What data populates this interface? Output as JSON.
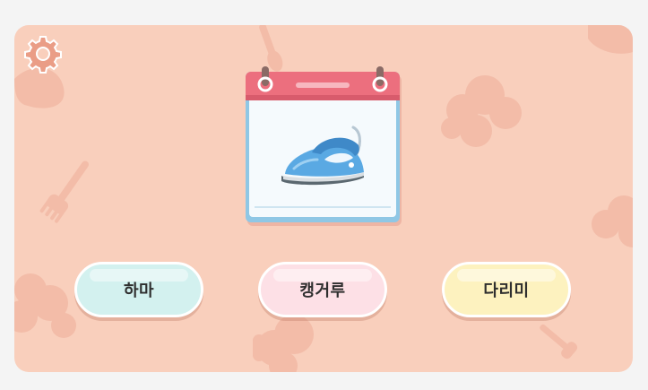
{
  "game": {
    "settings_icon": "gear-icon",
    "question_image": "clothes-iron",
    "answers": [
      {
        "label": "하마",
        "color": "#d3f1ef"
      },
      {
        "label": "캥거루",
        "color": "#fde0e6"
      },
      {
        "label": "다리미",
        "color": "#fdf2bf"
      }
    ]
  },
  "colors": {
    "background": "#f9cfbc",
    "calendar_header": "#ec6f7e",
    "calendar_border": "#8fc7e5",
    "iron_blue": "#5aa9e3"
  }
}
